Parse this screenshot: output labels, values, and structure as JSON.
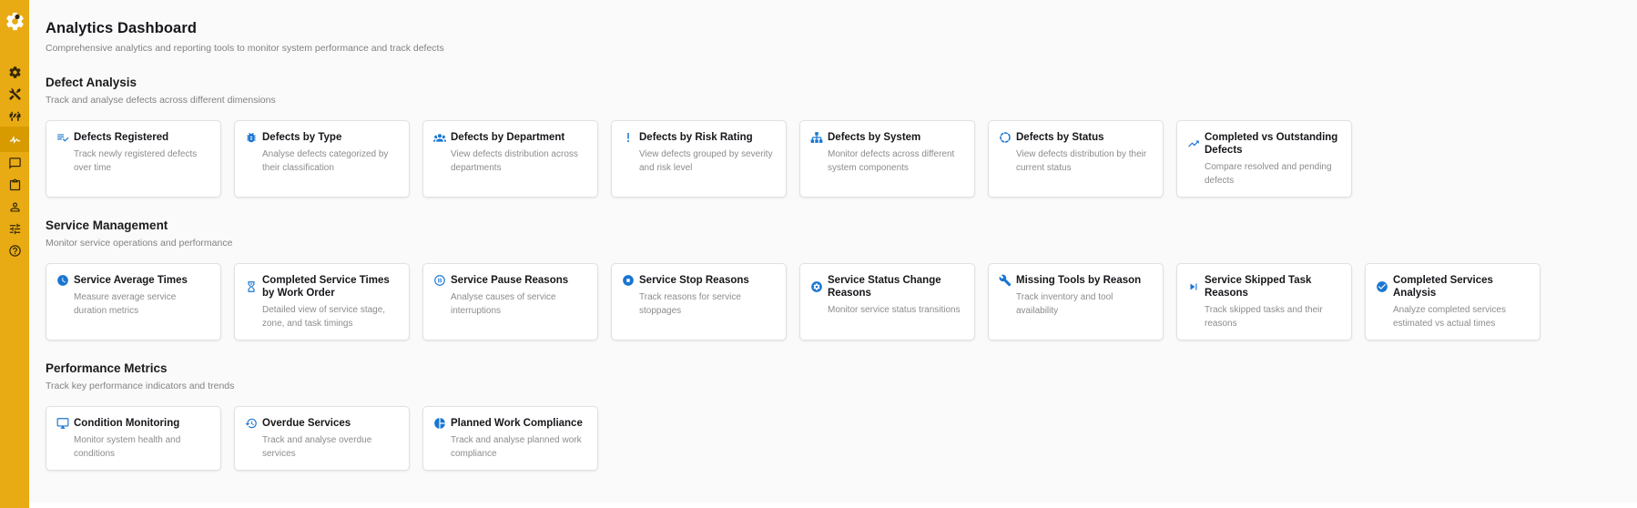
{
  "page": {
    "title": "Analytics Dashboard",
    "subtitle": "Comprehensive analytics and reporting tools to monitor system performance and track defects"
  },
  "colors": {
    "sidebar": "#E9AB13",
    "sidebar_active": "#D79B00",
    "accent": "#1976D2",
    "background": "#FAFAFA"
  },
  "sidebar": {
    "logo_icon": "app-logo-icon",
    "items": [
      {
        "name": "gear",
        "icon": "cog-icon",
        "active": false
      },
      {
        "name": "tools",
        "icon": "tools-icon",
        "active": false
      },
      {
        "name": "barrier",
        "icon": "barrier-icon",
        "active": false
      },
      {
        "name": "analytics",
        "icon": "pulse-icon",
        "active": true
      },
      {
        "name": "chat",
        "icon": "chat-icon",
        "active": false
      },
      {
        "name": "clipboard",
        "icon": "clipboard-icon",
        "active": false
      },
      {
        "name": "user",
        "icon": "person-icon",
        "active": false
      },
      {
        "name": "settings",
        "icon": "tune-icon",
        "active": false
      },
      {
        "name": "help",
        "icon": "help-icon",
        "active": false
      }
    ]
  },
  "sections": [
    {
      "title": "Defect Analysis",
      "subtitle": "Track and analyse defects across different dimensions",
      "cards": [
        {
          "icon": "playlist-check-icon",
          "title": "Defects Registered",
          "description": "Track newly registered defects over time"
        },
        {
          "icon": "bug-icon",
          "title": "Defects by Type",
          "description": "Analyse defects categorized by their classification"
        },
        {
          "icon": "people-group-icon",
          "title": "Defects by Department",
          "description": "View defects distribution across departments"
        },
        {
          "icon": "exclamation-icon",
          "title": "Defects by Risk Rating",
          "description": "View defects grouped by severity and risk level"
        },
        {
          "icon": "sitemap-icon",
          "title": "Defects by System",
          "description": "Monitor defects across different system components"
        },
        {
          "icon": "status-circle-icon",
          "title": "Defects by Status",
          "description": "View defects distribution by their current status"
        },
        {
          "icon": "trending-up-icon",
          "title": "Completed vs Outstanding Defects",
          "description": "Compare resolved and pending defects"
        }
      ]
    },
    {
      "title": "Service Management",
      "subtitle": "Monitor service operations and performance",
      "cards": [
        {
          "icon": "clock-icon",
          "title": "Service Average Times",
          "description": "Measure average service duration metrics"
        },
        {
          "icon": "hourglass-icon",
          "title": "Completed Service Times by Work Order",
          "description": "Detailed view of service stage, zone, and task timings"
        },
        {
          "icon": "pause-circle-icon",
          "title": "Service Pause Reasons",
          "description": "Analyse causes of service interruptions"
        },
        {
          "icon": "stop-circle-icon",
          "title": "Service Stop Reasons",
          "description": "Track reasons for service stoppages"
        },
        {
          "icon": "cog-circle-icon",
          "title": "Service Status Change Reasons",
          "description": "Monitor service status transitions"
        },
        {
          "icon": "wrench-icon",
          "title": "Missing Tools by Reason",
          "description": "Track inventory and tool availability"
        },
        {
          "icon": "skip-next-icon",
          "title": "Service Skipped Task Reasons",
          "description": "Track skipped tasks and their reasons"
        },
        {
          "icon": "check-circle-icon",
          "title": "Completed Services Analysis",
          "description": "Analyze completed services estimated vs actual times"
        }
      ]
    },
    {
      "title": "Performance Metrics",
      "subtitle": "Track key performance indicators and trends",
      "cards": [
        {
          "icon": "monitor-icon",
          "title": "Condition Monitoring",
          "description": "Monitor system health and conditions"
        },
        {
          "icon": "history-clock-icon",
          "title": "Overdue Services",
          "description": "Track and analyse overdue services"
        },
        {
          "icon": "pie-chart-icon",
          "title": "Planned Work Compliance",
          "description": "Track and analyse planned work compliance"
        }
      ]
    }
  ]
}
